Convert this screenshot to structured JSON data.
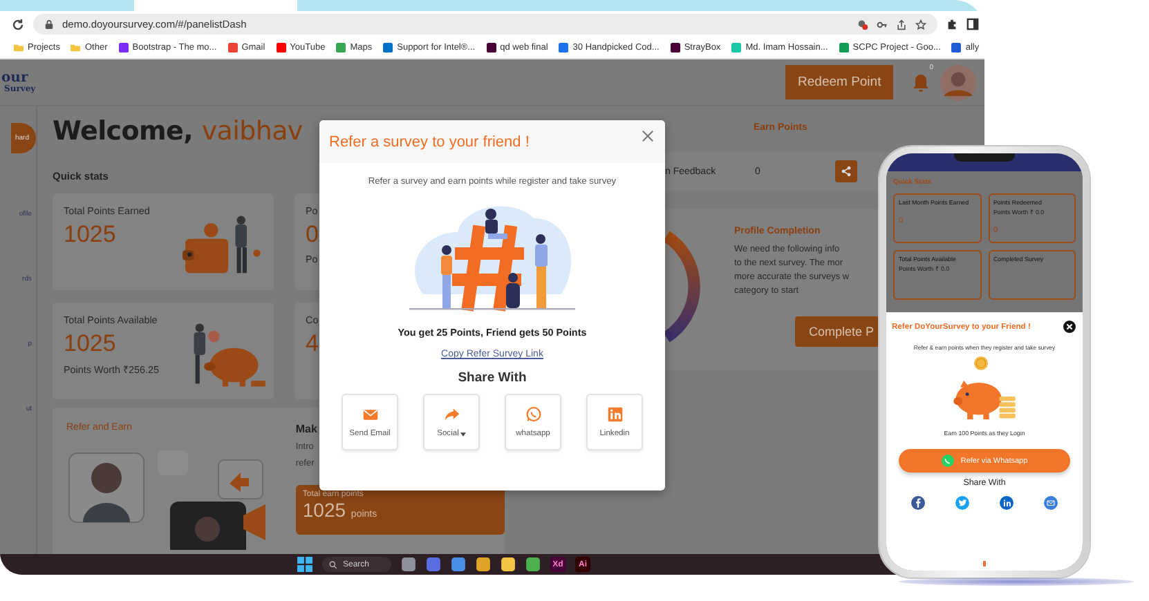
{
  "browser": {
    "url": "demo.doyoursurvey.com/#/panelistDash",
    "bookmarks": [
      {
        "label": "Projects",
        "kind": "folder",
        "color": "#f4c542"
      },
      {
        "label": "Other",
        "kind": "folder",
        "color": "#f4c542"
      },
      {
        "label": "Bootstrap - The mo...",
        "kind": "site",
        "color": "#7b2cf5"
      },
      {
        "label": "Gmail",
        "kind": "site",
        "color": "#ea4335"
      },
      {
        "label": "YouTube",
        "kind": "site",
        "color": "#ff0000"
      },
      {
        "label": "Maps",
        "kind": "site",
        "color": "#34a853"
      },
      {
        "label": "Support for Intel®...",
        "kind": "site",
        "color": "#0071c5"
      },
      {
        "label": "qd web final",
        "kind": "site",
        "color": "#470137"
      },
      {
        "label": "30 Handpicked Cod...",
        "kind": "site",
        "color": "#1a73e8"
      },
      {
        "label": "StrayBox",
        "kind": "site",
        "color": "#470137"
      },
      {
        "label": "Md. Imam Hossain...",
        "kind": "site",
        "color": "#19c9a5"
      },
      {
        "label": "SCPC Project - Goo...",
        "kind": "site",
        "color": "#0f9d58"
      },
      {
        "label": "ally",
        "kind": "site",
        "color": "#1e5bd6"
      }
    ]
  },
  "header": {
    "logo": [
      "our",
      "Survey"
    ],
    "redeem_button": "Redeem Point",
    "notification_count": "0"
  },
  "sidebar": [
    {
      "label": "hard",
      "selected": true
    },
    {
      "label": "ofile",
      "selected": false
    },
    {
      "label": "rds",
      "selected": false
    },
    {
      "label": "p",
      "selected": false
    },
    {
      "label": "ut",
      "selected": false
    }
  ],
  "welcome": {
    "greeting": "Welcome,",
    "name": "vaibhav"
  },
  "quick_stats": {
    "title": "Quick stats",
    "cards": [
      {
        "title": "Total Points Earned",
        "value": "1025",
        "kind": "wallet"
      },
      {
        "title": "Po",
        "value": "0",
        "note": "Po",
        "kind": "plain"
      },
      {
        "title": "Total Points Available",
        "value": "1025",
        "note": "Points Worth ₹256.25",
        "kind": "piggy"
      },
      {
        "title": "Co",
        "value": "4",
        "kind": "plain"
      }
    ]
  },
  "refer_card": {
    "title": "Refer and Earn",
    "heading": "Mak",
    "lines": [
      "Intro",
      "refer"
    ],
    "total_label": "Total earn points",
    "total_value": "1025",
    "total_unit": "points"
  },
  "earn_table": {
    "header": "Earn Points",
    "rows": [
      {
        "activity": "n Feedback",
        "points": "0"
      }
    ]
  },
  "profile": {
    "title": "Profile Completion",
    "lines": [
      "We need the following info",
      "to the next survey. The mor",
      "more accurate the surveys w",
      "category to start"
    ],
    "button": "Complete P"
  },
  "taskbar": {
    "search": "Search",
    "apps": [
      {
        "kind": "icon",
        "color": "#8d8f9a"
      },
      {
        "kind": "icon",
        "color": "#5b6ee1"
      },
      {
        "kind": "icon",
        "color": "#4a8fe7"
      },
      {
        "kind": "icon",
        "color": "#e0a526"
      },
      {
        "kind": "icon",
        "color": "#f4c542"
      },
      {
        "kind": "icon",
        "color": "#4caf50"
      },
      {
        "kind": "label",
        "label": "Xd",
        "color": "#470137"
      },
      {
        "kind": "label",
        "label": "Ai",
        "color": "#330000"
      }
    ]
  },
  "modal": {
    "title": "Refer a survey to your friend !",
    "subtitle": "Refer a survey and earn points while register and take survey",
    "reward": "You get 25 Points, Friend gets 50 Points",
    "link": "Copy Refer Survey Link",
    "share_title": "Share With",
    "share_options": [
      {
        "label": "Send Email",
        "kind": "email"
      },
      {
        "label": "Social",
        "kind": "social"
      },
      {
        "label": "whatsapp",
        "kind": "whatsapp"
      },
      {
        "label": "Linkedin",
        "kind": "linkedin"
      }
    ]
  },
  "phone": {
    "quick_stats": "Quick Stats",
    "cards": [
      {
        "title": "Last Month Points Earned",
        "value": "0"
      },
      {
        "title": "Points Redeemed",
        "note": "Points Worth ₹ 0.0",
        "value": "0"
      },
      {
        "title": "Total Points Available",
        "note": "Points Worth ₹ 0.0"
      },
      {
        "title": "Completed Survey"
      }
    ],
    "sheet": {
      "title": "Refer DoYourSurvey to your Friend !",
      "subtitle": "Refer & earn points when they register and take survey",
      "caption": "Earn 100 Points as they Login",
      "button": "Refer via Whatsapp",
      "share_title": "Share With",
      "share_icons": [
        {
          "kind": "facebook",
          "color": "#3b5998"
        },
        {
          "kind": "twitter",
          "color": "#1da1f2"
        },
        {
          "kind": "linkedin",
          "color": "#0a66c2"
        },
        {
          "kind": "email",
          "color": "#3d7dd8"
        }
      ]
    }
  }
}
